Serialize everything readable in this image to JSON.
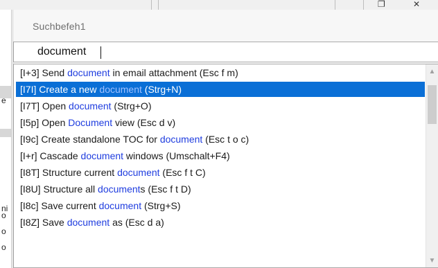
{
  "popup": {
    "title": "Suchbefeh1",
    "search_value": "document"
  },
  "background": {
    "left_fragments": [
      "e",
      "ni",
      "o",
      "o",
      "o"
    ]
  },
  "colors": {
    "selection": "#0a6fd6",
    "match_highlight": "#1f3ddf"
  },
  "results": [
    {
      "pre": "[I+3] Send ",
      "match": "document",
      "post": " in email attachment  (Esc f m)",
      "selected": false
    },
    {
      "pre": "[I7I] Create a new ",
      "match": "document",
      "post": "  (Strg+N)",
      "selected": true
    },
    {
      "pre": "[I7T] Open ",
      "match": "document",
      "post": "  (Strg+O)",
      "selected": false
    },
    {
      "pre": "[I5p] Open ",
      "match": "Document",
      "post": " view  (Esc d v)",
      "selected": false
    },
    {
      "pre": "[I9c] Create standalone TOC for ",
      "match": "document",
      "post": "  (Esc t o c)",
      "selected": false
    },
    {
      "pre": "[I+r] Cascade ",
      "match": "document",
      "post": " windows  (Umschalt+F4)",
      "selected": false
    },
    {
      "pre": "[I8T] Structure current ",
      "match": "document",
      "post": "  (Esc f t C)",
      "selected": false
    },
    {
      "pre": "[I8U] Structure all ",
      "match": "document",
      "post": "s  (Esc f t D)",
      "selected": false
    },
    {
      "pre": "[I8c] Save current ",
      "match": "document",
      "post": "  (Strg+S)",
      "selected": false
    },
    {
      "pre": "[I8Z] Save ",
      "match": "document",
      "post": " as  (Esc d a)",
      "selected": false
    }
  ],
  "icons": {
    "scroll_up": "scroll-up-arrow-icon",
    "scroll_down": "scroll-down-arrow-icon"
  }
}
